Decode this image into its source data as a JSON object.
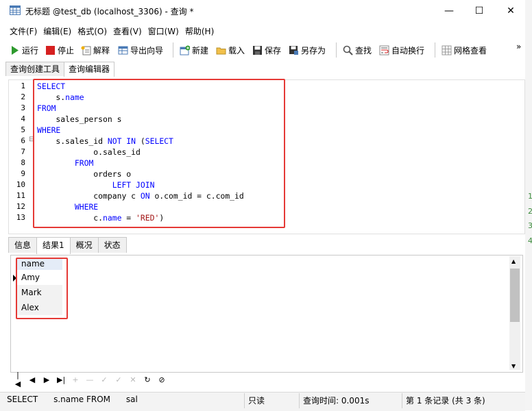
{
  "window": {
    "title": "无标题 @test_db (localhost_3306) - 查询 *",
    "controls": {
      "minimize": "—",
      "maximize": "☐",
      "close": "✕"
    }
  },
  "menu": [
    "文件(F)",
    "编辑(E)",
    "格式(O)",
    "查看(V)",
    "窗口(W)",
    "帮助(H)"
  ],
  "toolbar": {
    "run": "运行",
    "stop": "停止",
    "explain": "解释",
    "export": "导出向导",
    "new": "新建",
    "load": "载入",
    "save": "保存",
    "save_as": "另存为",
    "find": "查找",
    "wrap": "自动换行",
    "grid_view": "网格查看",
    "overflow": "»"
  },
  "query_tabs": [
    "查询创建工具",
    "查询编辑器"
  ],
  "editor": {
    "line_numbers": [
      "1",
      "2",
      "3",
      "4",
      "5",
      "6",
      "7",
      "8",
      "9",
      "10",
      "11",
      "12",
      "13"
    ],
    "fold_marker": "⊟"
  },
  "right_strip": [
    "1",
    "2",
    "3",
    "4"
  ],
  "result_tabs": [
    "信息",
    "结果1",
    "概况",
    "状态"
  ],
  "grid": {
    "column": "name",
    "rows": [
      "Amy",
      "Mark",
      "Alex"
    ]
  },
  "nav": [
    "|◀",
    "◀",
    "▶",
    "▶|",
    "+",
    "—",
    "✓",
    "✓",
    "✕",
    "↻",
    "⊘"
  ],
  "status": {
    "sql": "SELECT      s.name FROM      sal",
    "mode": "只读",
    "time": "查询时间: 0.001s",
    "records": "第 1 条记录 (共 3 条)"
  },
  "colors": {
    "keyword": "#0000ff",
    "string": "#a31515",
    "highlight_box": "#e53935"
  }
}
